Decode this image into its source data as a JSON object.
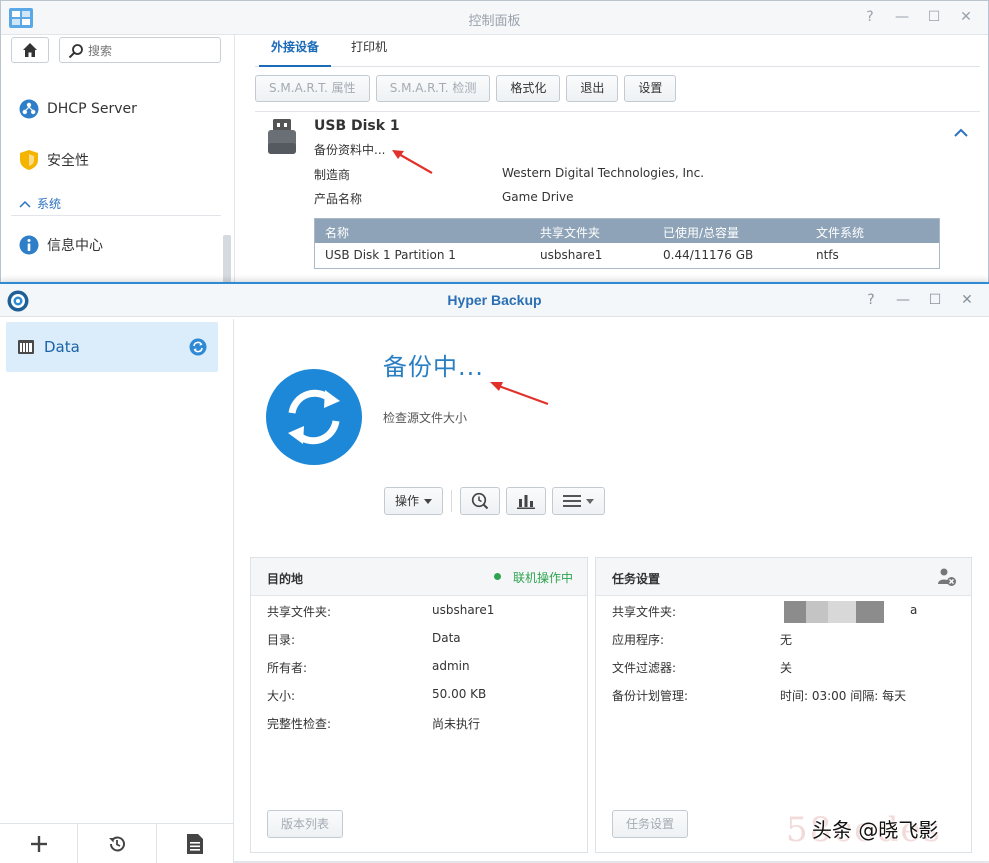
{
  "control_panel": {
    "title": "控制面板",
    "window_buttons": [
      "?",
      "—",
      "☐",
      "✕"
    ],
    "search": {
      "placeholder": "搜索"
    },
    "sidebar": {
      "items": [
        {
          "label": "DHCP Server",
          "icon": "dhcp-icon"
        },
        {
          "label": "安全性",
          "icon": "shield-icon"
        },
        {
          "label": "信息中心",
          "icon": "info-icon"
        }
      ],
      "section_label": "系统"
    },
    "tabs": [
      {
        "label": "外接设备",
        "active": true
      },
      {
        "label": "打印机",
        "active": false
      }
    ],
    "toolbar": [
      {
        "label": "S.M.A.R.T. 属性",
        "disabled": true
      },
      {
        "label": "S.M.A.R.T. 检测",
        "disabled": true
      },
      {
        "label": "格式化",
        "disabled": false
      },
      {
        "label": "退出",
        "disabled": false
      },
      {
        "label": "设置",
        "disabled": false
      }
    ],
    "device": {
      "name": "USB Disk 1",
      "status": "备份资料中...",
      "manufacturer_label": "制造商",
      "manufacturer": "Western Digital Technologies, Inc.",
      "product_label": "产品名称",
      "product": "Game Drive"
    },
    "partition_table": {
      "headers": [
        "名称",
        "共享文件夹",
        "已使用/总容量",
        "文件系统"
      ],
      "rows": [
        [
          "USB Disk 1 Partition 1",
          "usbshare1",
          "0.44/11176 GB",
          "ntfs"
        ]
      ]
    }
  },
  "hyper_backup": {
    "title": "Hyper Backup",
    "window_buttons": [
      "?",
      "—",
      "☐",
      "✕"
    ],
    "task": {
      "label": "Data"
    },
    "status_title": "备份中...",
    "status_sub": "检查源文件大小",
    "actions_label": "操作",
    "destination": {
      "title": "目的地",
      "online_status": "联机操作中",
      "status_color": "#2ea44f",
      "rows": [
        {
          "label": "共享文件夹:",
          "value": "usbshare1"
        },
        {
          "label": "目录:",
          "value": "Data"
        },
        {
          "label": "所有者:",
          "value": "admin"
        },
        {
          "label": "大小:",
          "value": "50.00 KB"
        },
        {
          "label": "完整性检查:",
          "value": "尚未执行"
        }
      ],
      "button": "版本列表"
    },
    "task_settings": {
      "title": "任务设置",
      "rows": [
        {
          "label": "共享文件夹:",
          "value": "a"
        },
        {
          "label": "应用程序:",
          "value": "无"
        },
        {
          "label": "文件过滤器:",
          "value": "关"
        },
        {
          "label": "备份计划管理:",
          "value": "时间: 03:00 间隔: 每天"
        }
      ],
      "button": "任务设置"
    }
  },
  "watermark": {
    "back": "58codes",
    "front": "头条 @晓飞影"
  },
  "colors": {
    "accent": "#2a7fc3",
    "arrow": "#e0322a"
  }
}
